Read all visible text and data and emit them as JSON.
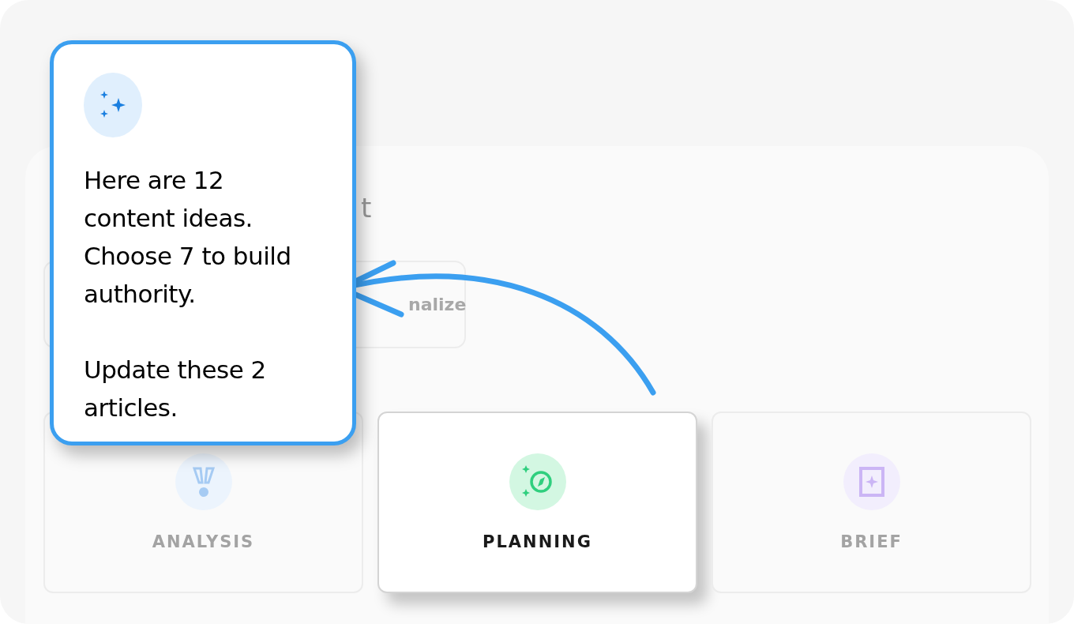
{
  "panel": {
    "heading_fragment": "t",
    "buttons": [
      {
        "kind": "wide"
      },
      {
        "kind": "narrow",
        "label": "nalize"
      }
    ]
  },
  "steps": [
    {
      "label": "ANALYSIS",
      "kind": "analysis",
      "selected": false
    },
    {
      "label": "PLANNING",
      "kind": "planning",
      "selected": true
    },
    {
      "label": "BRIEF",
      "kind": "brief",
      "selected": false
    }
  ],
  "callout": {
    "lines": [
      "Here are 12 content ideas. Choose 7 to build authority.",
      "Update these 2 articles."
    ]
  }
}
